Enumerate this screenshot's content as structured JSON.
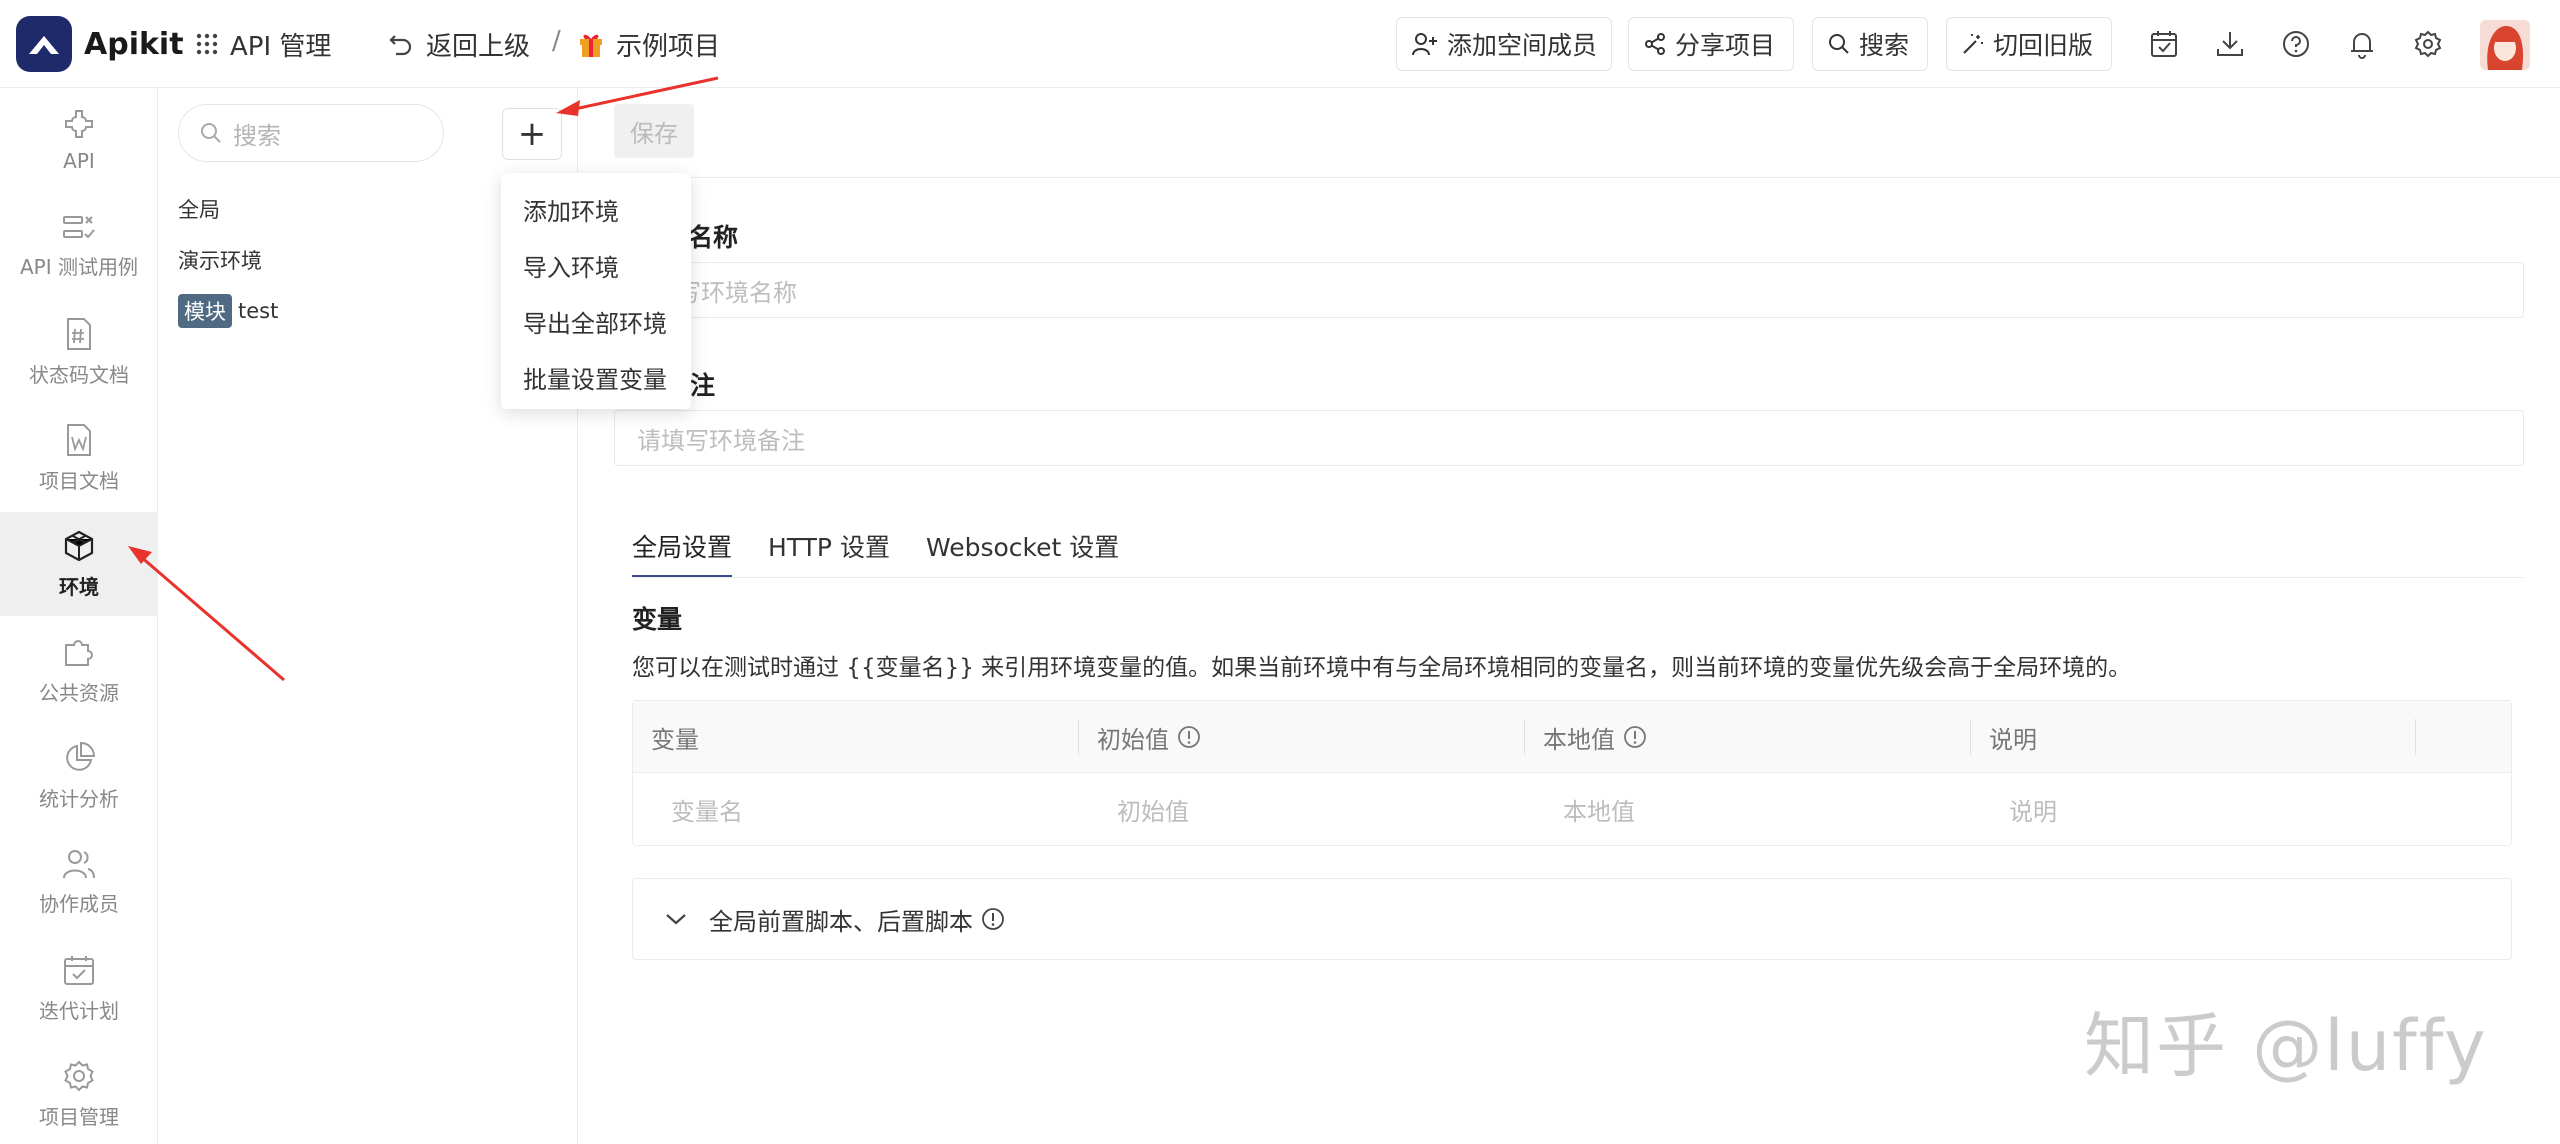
{
  "app": {
    "name": "Apikit",
    "brand_color": "#1f2a6b"
  },
  "topbar": {
    "api_manage": "API 管理",
    "back": "返回上级",
    "separator": "/",
    "project": "示例项目",
    "buttons": {
      "add_member": "添加空间成员",
      "share": "分享项目",
      "search": "搜索",
      "old_version": "切回旧版"
    },
    "icons": [
      "calendar-check-icon",
      "download-icon",
      "help-icon",
      "bell-icon",
      "gear-icon"
    ]
  },
  "sidebar": {
    "items": [
      {
        "label": "API",
        "icon": "api-icon"
      },
      {
        "label": "API 测试用例",
        "icon": "test-case-icon"
      },
      {
        "label": "状态码文档",
        "icon": "status-code-icon"
      },
      {
        "label": "项目文档",
        "icon": "doc-icon"
      },
      {
        "label": "环境",
        "icon": "cube-icon",
        "active": true
      },
      {
        "label": "公共资源",
        "icon": "puzzle-icon"
      },
      {
        "label": "统计分析",
        "icon": "pie-chart-icon"
      },
      {
        "label": "协作成员",
        "icon": "users-icon"
      },
      {
        "label": "迭代计划",
        "icon": "calendar-icon"
      },
      {
        "label": "项目管理",
        "icon": "settings-icon"
      }
    ]
  },
  "envpanel": {
    "search_placeholder": "搜索",
    "add_symbol": "+",
    "items": [
      {
        "label": "全局"
      },
      {
        "label": "演示环境"
      },
      {
        "tag": "模块",
        "label": "test"
      }
    ]
  },
  "menu": {
    "items": [
      "添加环境",
      "导入环境",
      "导出全部环境",
      "批量设置变量"
    ]
  },
  "main": {
    "save": "保存",
    "name_label": "名称",
    "name_placeholder": "写环境名称",
    "remark_label": "注",
    "remark_placeholder": "请填写环境备注",
    "tabs": [
      "全局设置",
      "HTTP 设置",
      "Websocket 设置"
    ],
    "variables_title": "变量",
    "variables_desc": "您可以在测试时通过 {{变量名}} 来引用环境变量的值。如果当前环境中有与全局环境相同的变量名，则当前环境的变量优先级会高于全局环境的。",
    "table": {
      "headers": [
        "变量",
        "初始值",
        "本地值",
        "说明"
      ],
      "placeholders": [
        "变量名",
        "初始值",
        "本地值",
        "说明"
      ]
    },
    "scripts_label": "全局前置脚本、后置脚本"
  },
  "watermark": "知乎 @luffy",
  "annotation_color": "#e8322b"
}
